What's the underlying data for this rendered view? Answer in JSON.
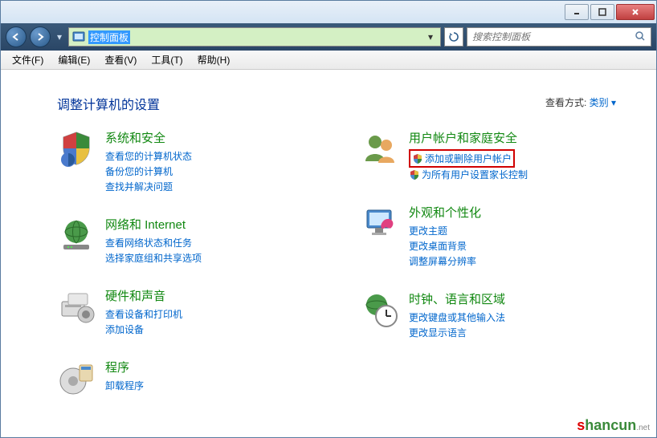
{
  "addressbar": {
    "text": "控制面板"
  },
  "search": {
    "placeholder": "搜索控制面板"
  },
  "menu": {
    "file": "文件(F)",
    "edit": "编辑(E)",
    "view": "查看(V)",
    "tools": "工具(T)",
    "help": "帮助(H)"
  },
  "heading": "调整计算机的设置",
  "viewby": {
    "label": "查看方式:",
    "value": "类别"
  },
  "categories": {
    "system": {
      "title": "系统和安全",
      "links": [
        "查看您的计算机状态",
        "备份您的计算机",
        "查找并解决问题"
      ]
    },
    "network": {
      "title": "网络和 Internet",
      "links": [
        "查看网络状态和任务",
        "选择家庭组和共享选项"
      ]
    },
    "hardware": {
      "title": "硬件和声音",
      "links": [
        "查看设备和打印机",
        "添加设备"
      ]
    },
    "programs": {
      "title": "程序",
      "links": [
        "卸载程序"
      ]
    },
    "users": {
      "title": "用户帐户和家庭安全",
      "links": [
        "添加或删除用户帐户",
        "为所有用户设置家长控制"
      ]
    },
    "appearance": {
      "title": "外观和个性化",
      "links": [
        "更改主题",
        "更改桌面背景",
        "调整屏幕分辨率"
      ]
    },
    "clock": {
      "title": "时钟、语言和区域",
      "links": [
        "更改键盘或其他输入法",
        "更改显示语言"
      ]
    }
  },
  "watermark": {
    "text": "shancun",
    "suffix": ".net"
  }
}
